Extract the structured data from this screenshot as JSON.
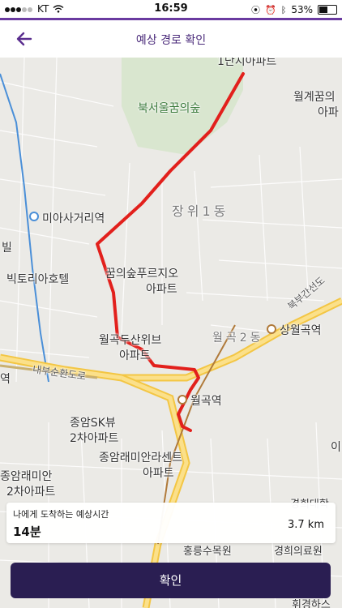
{
  "status": {
    "carrier": "KT",
    "time": "16:59",
    "battery": "53%",
    "icons": [
      "signal-icon",
      "wifi-icon",
      "location-icon",
      "alarm-icon",
      "bluetooth-icon",
      "battery-icon"
    ]
  },
  "nav": {
    "title": "예상 경로 확인",
    "back_icon": "back-arrow-icon"
  },
  "colors": {
    "accent": "#2a1e52",
    "route": "#e2201c",
    "status_line": "#6a3aa0"
  },
  "map": {
    "labels": {
      "apt_top": "1단지아파트",
      "wolgye_top": "월계꿈의",
      "wolgye_top2": "아파",
      "forest": "북서울꿈의숲",
      "jangwi": "장위1동",
      "miasa": "미아사거리역",
      "bil": "빌",
      "victoria": "빅토리아호텔",
      "dream_prugio": "꿈의숲푸르지오",
      "dream_prugio2": "아파트",
      "northern": "북부간선도",
      "sangwol": "상월곡역",
      "wolgok_dusan": "월곡두산위브",
      "wolgok_dusan2": "아파트",
      "wolgok_area": "월곡2동",
      "naebu": "내부순환도로",
      "yeok": "역",
      "wolgok_station": "월곡역",
      "jongam_sk": "종암SK뷰",
      "jongam_sk2": "2차아파트",
      "jongam_raemian_center": "종암래미안라센트",
      "jongam_raemian_center2": "아파트",
      "jongam_raemian2": "종암래미안",
      "jongam_raemian2b": "2차아파트",
      "i": "이",
      "kyunghee": "경희대학",
      "kyunghee_med": "경희의료원",
      "hongneung": "홍릉수목원",
      "bottom": "휘경하스"
    }
  },
  "card": {
    "caption": "나에게 도착하는 예상시간",
    "eta": "14분",
    "distance": "3.7 km"
  },
  "confirm_label": "확인"
}
